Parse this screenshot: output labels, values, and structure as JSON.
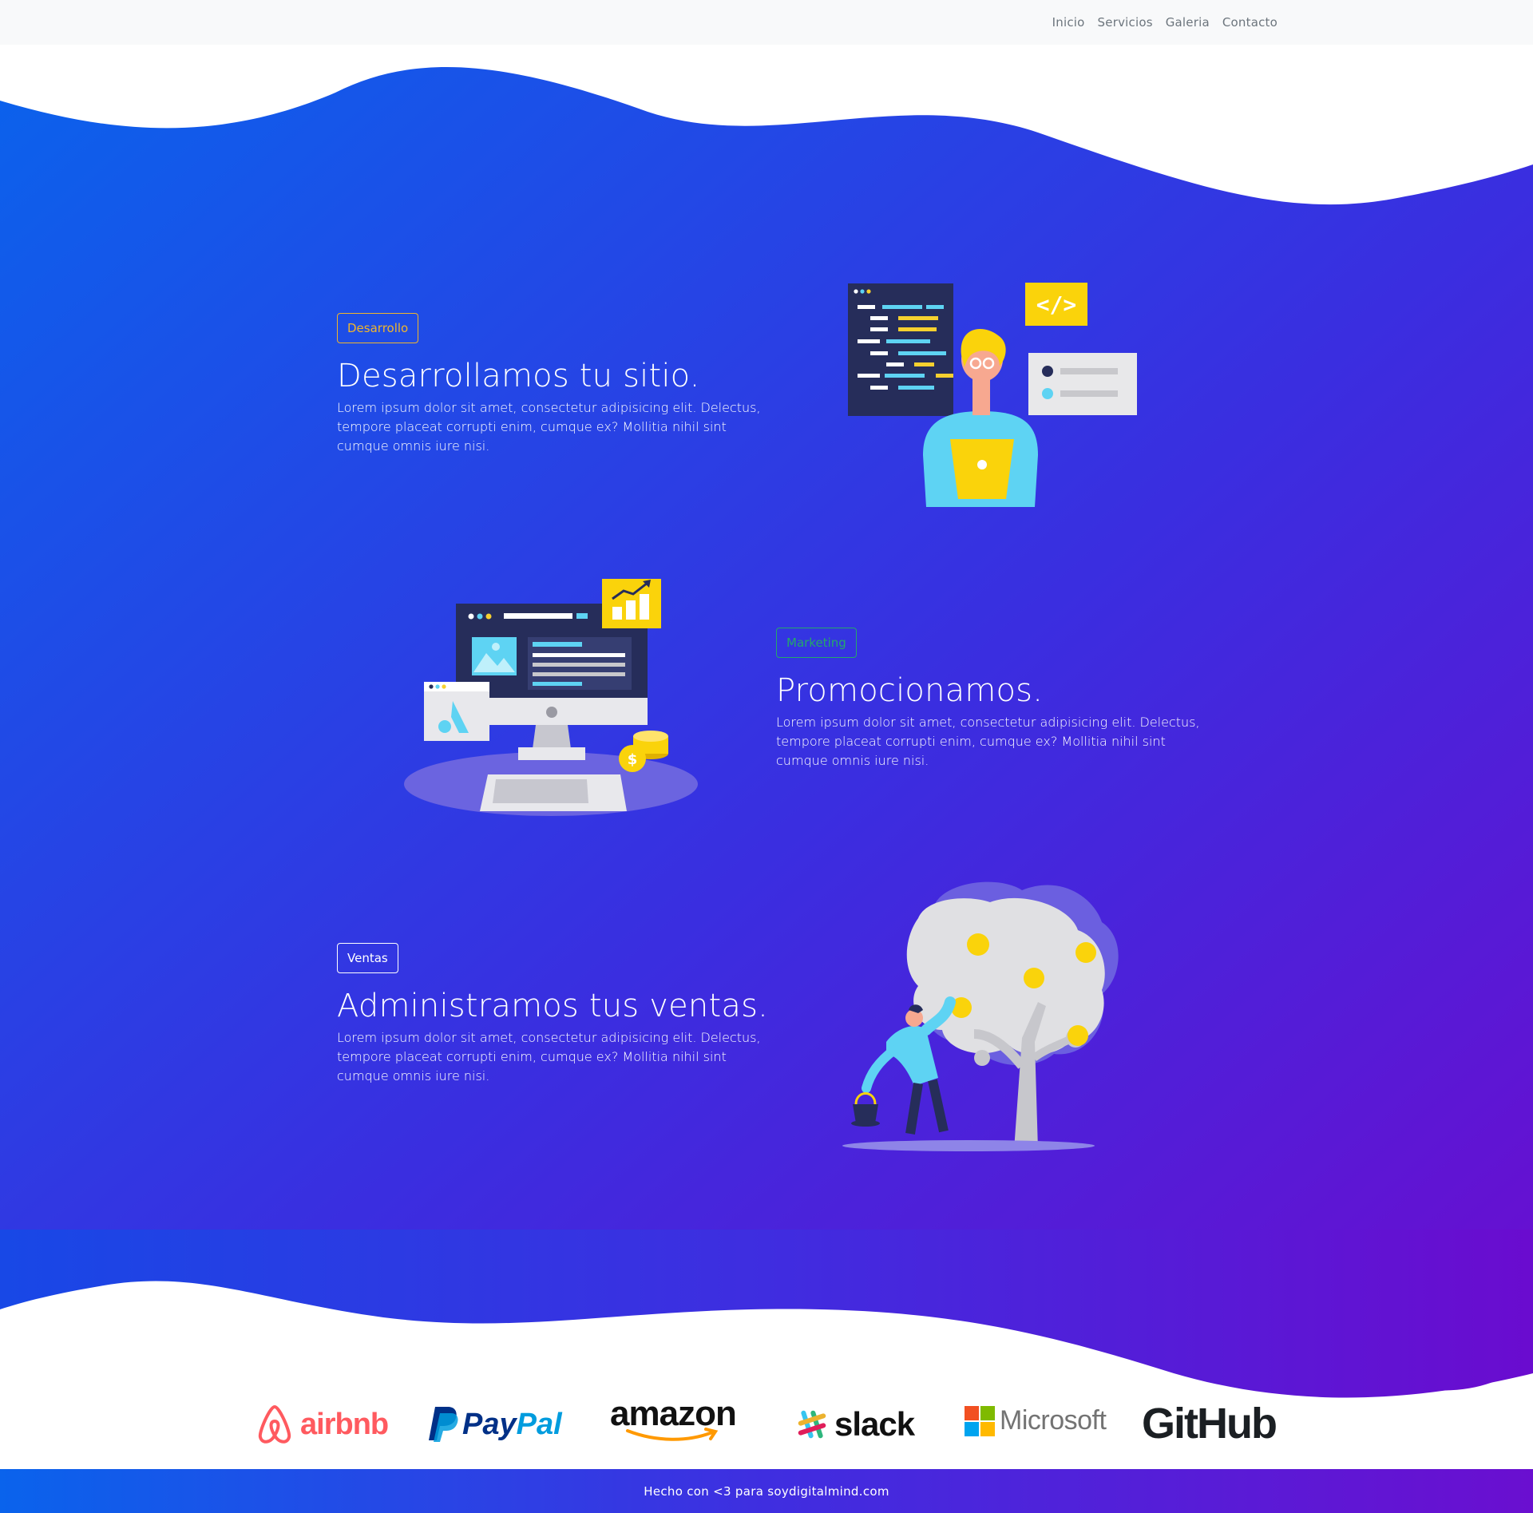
{
  "nav": {
    "items": [
      {
        "label": "Inicio"
      },
      {
        "label": "Servicios"
      },
      {
        "label": "Galeria"
      },
      {
        "label": "Contacto"
      }
    ]
  },
  "services": [
    {
      "badge": "Desarrollo",
      "title": "Desarrollamos tu sitio.",
      "text": "Lorem ipsum dolor sit amet, consectetur adipisicing elit. Delectus, tempore placeat corrupti enim, cumque ex? Mollitia nihil sint cumque omnis iure nisi."
    },
    {
      "badge": "Marketing",
      "title": "Promocionamos.",
      "text": "Lorem ipsum dolor sit amet, consectetur adipisicing elit. Delectus, tempore placeat corrupti enim, cumque ex? Mollitia nihil sint cumque omnis iure nisi."
    },
    {
      "badge": "Ventas",
      "title": "Administramos tus ventas.",
      "text": "Lorem ipsum dolor sit amet, consectetur adipisicing elit. Delectus, tempore placeat corrupti enim, cumque ex? Mollitia nihil sint cumque omnis iure nisi."
    }
  ],
  "illustrations": {
    "dev": {
      "icon": "developer-illustration"
    },
    "mkt": {
      "icon": "marketing-computer-illustration",
      "code_tag": "</>"
    },
    "sales": {
      "icon": "money-tree-illustration",
      "coin_symbol": "$"
    }
  },
  "logos": {
    "airbnb": "airbnb",
    "paypal_pay": "Pay",
    "paypal_pal": "Pal",
    "amazon": "amazon",
    "slack": "slack",
    "microsoft": "Microsoft",
    "github": "GitHub"
  },
  "footer": {
    "text": "Hecho con <3 para soydigitalmind.com"
  },
  "colors": {
    "gradient_start": "#0a63ec",
    "gradient_mid": "#3f2ee0",
    "gradient_end": "#6a0fd0",
    "badge_dev": "#f0b52c",
    "badge_mkt": "#24a86b",
    "badge_sales": "#ffffff",
    "navbar_bg": "#f8f9fa"
  }
}
